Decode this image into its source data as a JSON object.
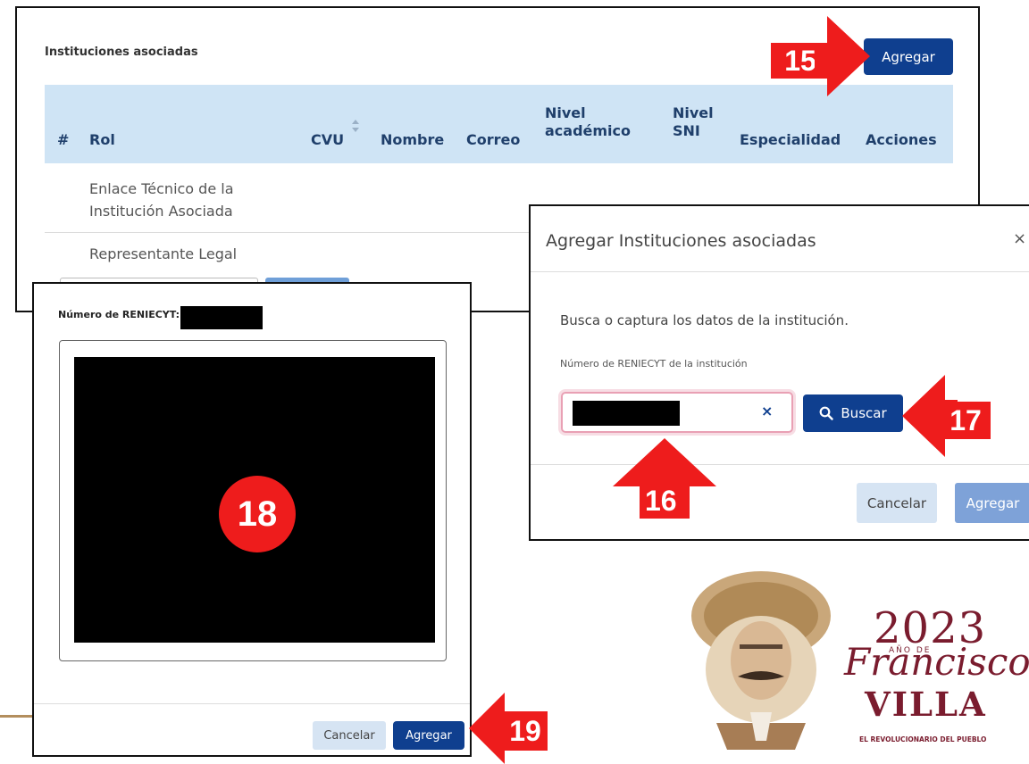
{
  "instituciones_panel": {
    "title": "Instituciones asociadas",
    "add_label": "Agregar",
    "columns": [
      "#",
      "Rol",
      "CVU",
      "Nombre",
      "Correo",
      "Nivel académico",
      "Nivel SNI",
      "Especialidad",
      "Acciones"
    ],
    "rows": [
      {
        "rol": "Enlace Técnico de la Institución Asociada"
      },
      {
        "rol": "Representante Legal"
      }
    ]
  },
  "modal_search": {
    "title": "Agregar Instituciones asociadas",
    "close_glyph": "×",
    "description": "Busca o captura los datos de la institución.",
    "field_label": "Número de RENIECYT de la institución",
    "clear_glyph": "×",
    "search_label": "Buscar",
    "cancel_label": "Cancelar",
    "add_label": "Agregar"
  },
  "modal_result": {
    "reniecyt_label": "Número de RENIECYT:",
    "cancel_label": "Cancelar",
    "add_label": "Agregar"
  },
  "annotations": {
    "step_15": "15",
    "step_16": "16",
    "step_17": "17",
    "step_18": "18",
    "step_19": "19"
  },
  "logo": {
    "year": "2023",
    "ano_de": "AÑO DE",
    "name": "Francisco",
    "surname": "VILLA",
    "tagline": "EL REVOLUCIONARIO DEL PUEBLO"
  },
  "colors": {
    "primary": "#0f3f8f",
    "primary_disabled": "#7ea2d8",
    "table_header": "#cfe4f5",
    "annotation_red": "#ee1c1c",
    "logo_red": "#7a1c2e"
  }
}
